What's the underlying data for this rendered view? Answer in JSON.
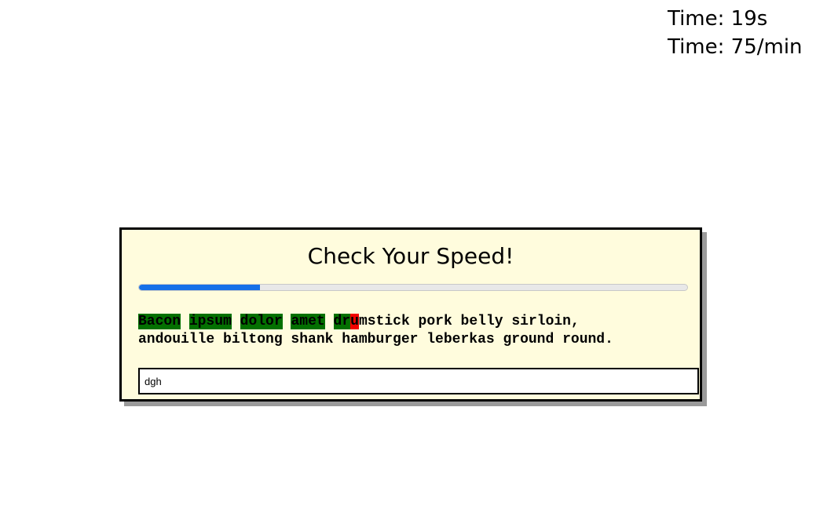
{
  "stats": {
    "time_label": "Time: 19s",
    "rate_label": "Time: 75/min"
  },
  "card": {
    "title": "Check Your Speed!",
    "progress_fraction": 0.22
  },
  "passage": {
    "correct_words": [
      "Bacon",
      "ipsum",
      "dolor",
      "amet"
    ],
    "current_correct": "dr",
    "current_error": "u",
    "remaining_line1": "mstick pork belly sirloin,",
    "line2": "andouille biltong shank hamburger leberkas ground round."
  },
  "input": {
    "value": "dgh"
  },
  "colors": {
    "correct": "#037000",
    "error": "#f20000",
    "progress": "#1670e8",
    "card_bg": "#fffcdd"
  }
}
